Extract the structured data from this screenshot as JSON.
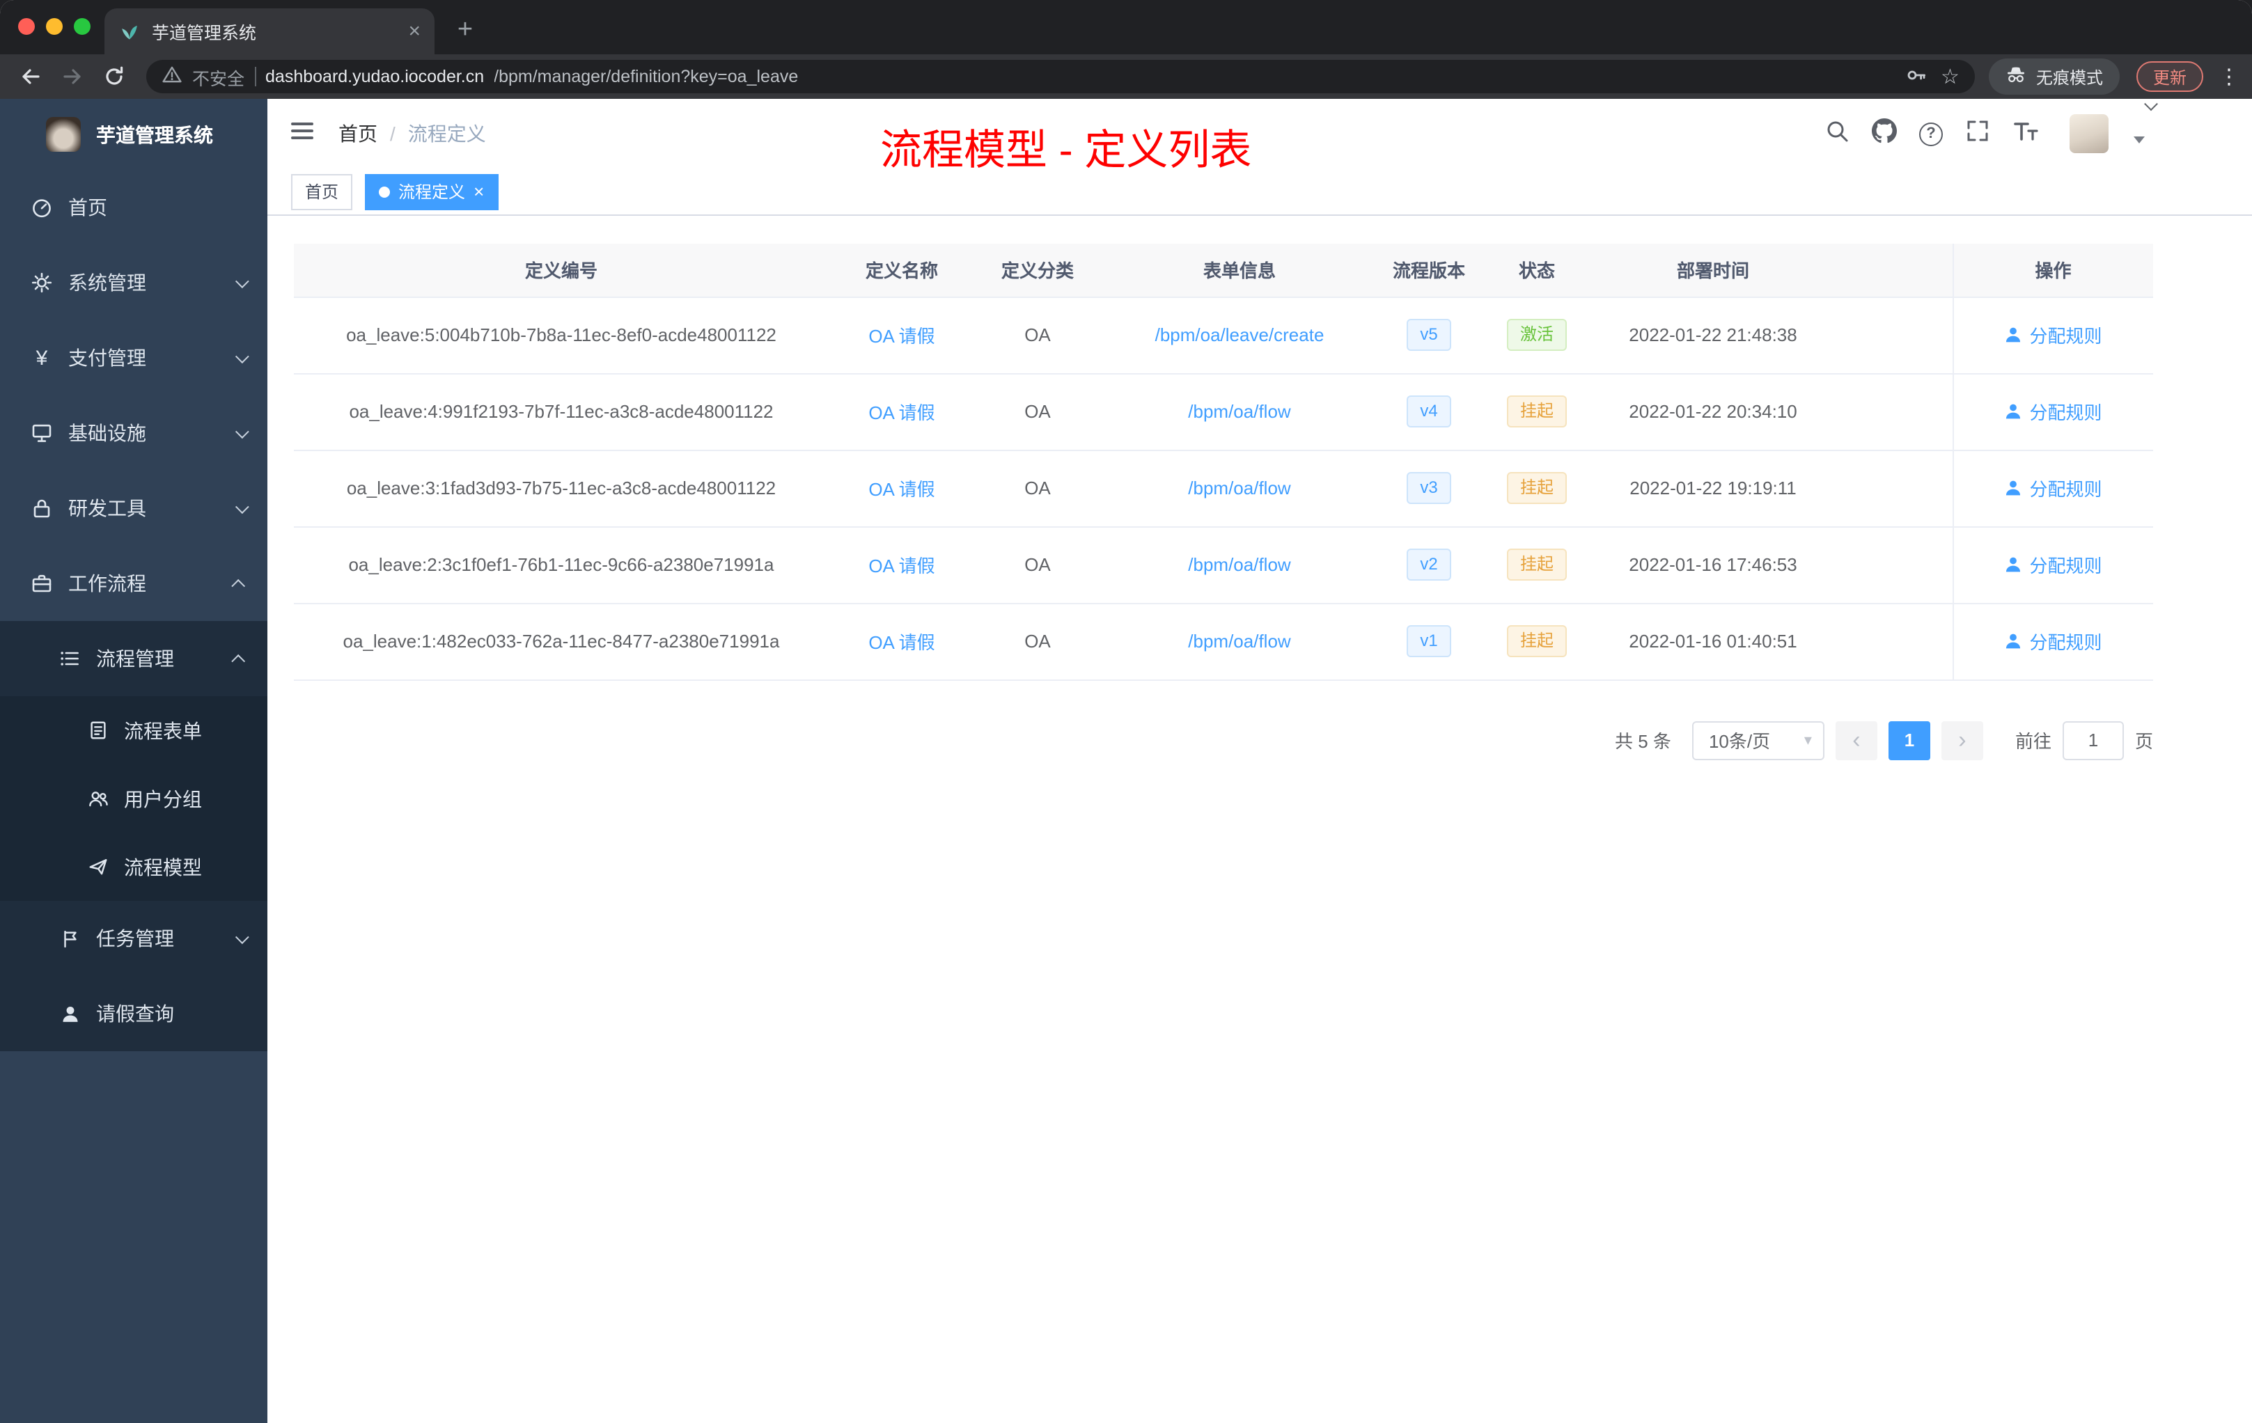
{
  "browser": {
    "tab_title": "芋道管理系统",
    "security_label": "不安全",
    "url_domain": "dashboard.yudao.iocoder.cn",
    "url_path": "/bpm/manager/definition?key=oa_leave",
    "incognito_label": "无痕模式",
    "update_label": "更新"
  },
  "glyphs": {
    "close": "×",
    "new_tab": "+",
    "kebab": "⋮",
    "star": "☆",
    "help": "?",
    "prev": "‹",
    "next": "›",
    "crumb_sep": "/",
    "yen": "¥",
    "caret_down": "▾"
  },
  "sidebar": {
    "title": "芋道管理系统",
    "items": [
      {
        "label": "首页",
        "icon": "dashboard-icon"
      },
      {
        "label": "系统管理",
        "icon": "gear-icon"
      },
      {
        "label": "支付管理",
        "icon": "yen-icon"
      },
      {
        "label": "基础设施",
        "icon": "infrastructure-icon"
      },
      {
        "label": "研发工具",
        "icon": "dev-tools-icon"
      },
      {
        "label": "工作流程",
        "icon": "workflow-icon"
      },
      {
        "label": "流程管理",
        "icon": "process-management-icon"
      },
      {
        "label": "流程表单",
        "icon": "process-form-icon"
      },
      {
        "label": "用户分组",
        "icon": "user-group-icon"
      },
      {
        "label": "流程模型",
        "icon": "process-model-icon"
      },
      {
        "label": "任务管理",
        "icon": "task-management-icon"
      },
      {
        "label": "请假查询",
        "icon": "leave-query-icon"
      }
    ]
  },
  "header": {
    "breadcrumb_home": "首页",
    "breadcrumb_current": "流程定义",
    "annotation": "流程模型 - 定义列表"
  },
  "tags": {
    "home": "首页",
    "active": "流程定义"
  },
  "table": {
    "columns": [
      "定义编号",
      "定义名称",
      "定义分类",
      "表单信息",
      "流程版本",
      "状态",
      "部署时间",
      "操作"
    ],
    "rows": [
      {
        "id": "oa_leave:5:004b710b-7b8a-11ec-8ef0-acde48001122",
        "name": "OA 请假",
        "category": "OA",
        "form": "/bpm/oa/leave/create",
        "version": "v5",
        "status": "激活",
        "time": "2022-01-22 21:48:38",
        "action": "分配规则"
      },
      {
        "id": "oa_leave:4:991f2193-7b7f-11ec-a3c8-acde48001122",
        "name": "OA 请假",
        "category": "OA",
        "form": "/bpm/oa/flow",
        "version": "v4",
        "status": "挂起",
        "time": "2022-01-22 20:34:10",
        "action": "分配规则"
      },
      {
        "id": "oa_leave:3:1fad3d93-7b75-11ec-a3c8-acde48001122",
        "name": "OA 请假",
        "category": "OA",
        "form": "/bpm/oa/flow",
        "version": "v3",
        "status": "挂起",
        "time": "2022-01-22 19:19:11",
        "action": "分配规则"
      },
      {
        "id": "oa_leave:2:3c1f0ef1-76b1-11ec-9c66-a2380e71991a",
        "name": "OA 请假",
        "category": "OA",
        "form": "/bpm/oa/flow",
        "version": "v2",
        "status": "挂起",
        "time": "2022-01-16 17:46:53",
        "action": "分配规则"
      },
      {
        "id": "oa_leave:1:482ec033-762a-11ec-8477-a2380e71991a",
        "name": "OA 请假",
        "category": "OA",
        "form": "/bpm/oa/flow",
        "version": "v1",
        "status": "挂起",
        "time": "2022-01-16 01:40:51",
        "action": "分配规则"
      }
    ]
  },
  "pagination": {
    "total": "共 5 条",
    "page_size": "10条/页",
    "page": "1",
    "goto_label": "前往",
    "goto_value": "1",
    "goto_unit": "页"
  },
  "colors": {
    "accent_blue": "#409eff",
    "status_active_green": "#67c23a",
    "status_suspended_orange": "#e6a23c",
    "annotation_red": "#fe0100",
    "sidebar_bg": "#304156",
    "sidebar_submenu_bg": "#1f2d3d",
    "browser_dark": "#202124"
  }
}
